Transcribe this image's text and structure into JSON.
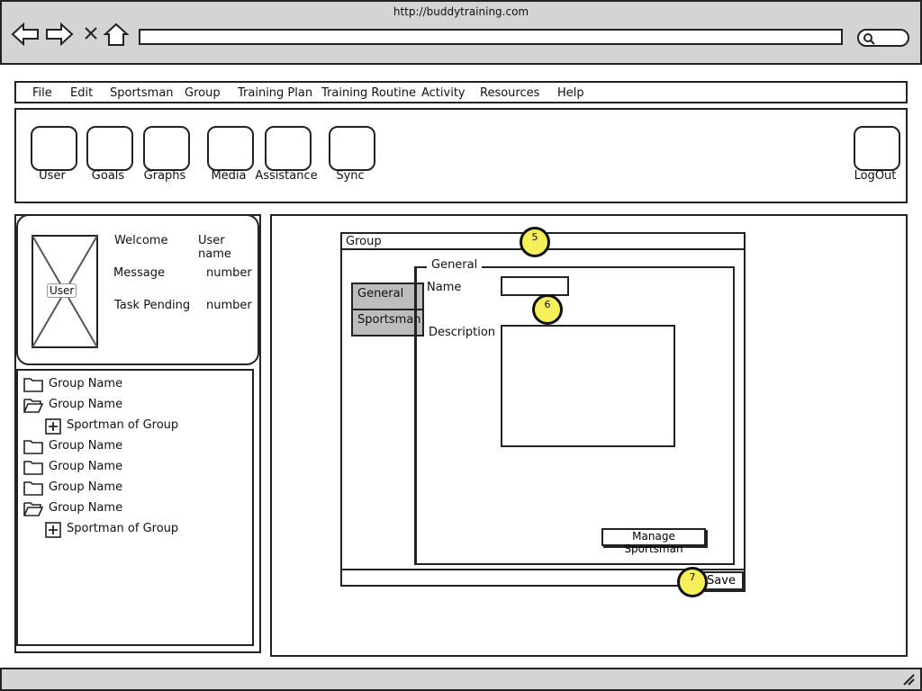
{
  "browser": {
    "url": "http://buddytraining.com",
    "nav_icons": [
      "back-arrow-icon",
      "forward-arrow-icon",
      "close-icon",
      "home-icon"
    ]
  },
  "menu": {
    "items": [
      "File",
      "Edit",
      "Sportsman",
      "Group",
      "Training Plan",
      "Training Routine",
      "Activity",
      "Resources",
      "Help"
    ]
  },
  "toolbar": {
    "buttons": [
      "User",
      "Goals",
      "Graphs",
      "Media",
      "Assistance",
      "Sync"
    ],
    "logout": "LogOut"
  },
  "user_card": {
    "avatar_label": "User",
    "welcome_label": "Welcome",
    "welcome_value": "User name",
    "message_label": "Message",
    "message_value": "number",
    "task_label": "Task Pending",
    "task_value": "number"
  },
  "tree": {
    "rows": [
      {
        "label": "Group Name",
        "icon": "folder-icon"
      },
      {
        "label": "Group Name",
        "icon": "folder-open-icon"
      },
      {
        "label": "Sportman of Group",
        "icon": "plus-box-icon"
      },
      {
        "label": "Group Name",
        "icon": "folder-icon"
      },
      {
        "label": "Group Name",
        "icon": "folder-icon"
      },
      {
        "label": "Group Name",
        "icon": "folder-icon"
      },
      {
        "label": "Group Name",
        "icon": "folder-open-icon"
      },
      {
        "label": "Sportman of Group",
        "icon": "plus-box-icon"
      }
    ]
  },
  "dialog": {
    "title": "Group",
    "tabs": [
      "General",
      "Sportsman"
    ],
    "group_legend": "General",
    "name_label": "Name",
    "name_value": "",
    "description_label": "Description",
    "description_value": "",
    "manage_button": "Manage Sportsman",
    "save_button": "Save"
  },
  "markers": [
    "5",
    "6",
    "7"
  ],
  "colors": {
    "chrome": "#d4d4d4",
    "tab": "#bdbdbd",
    "marker": "#f6ef5a",
    "line": "#222222"
  }
}
